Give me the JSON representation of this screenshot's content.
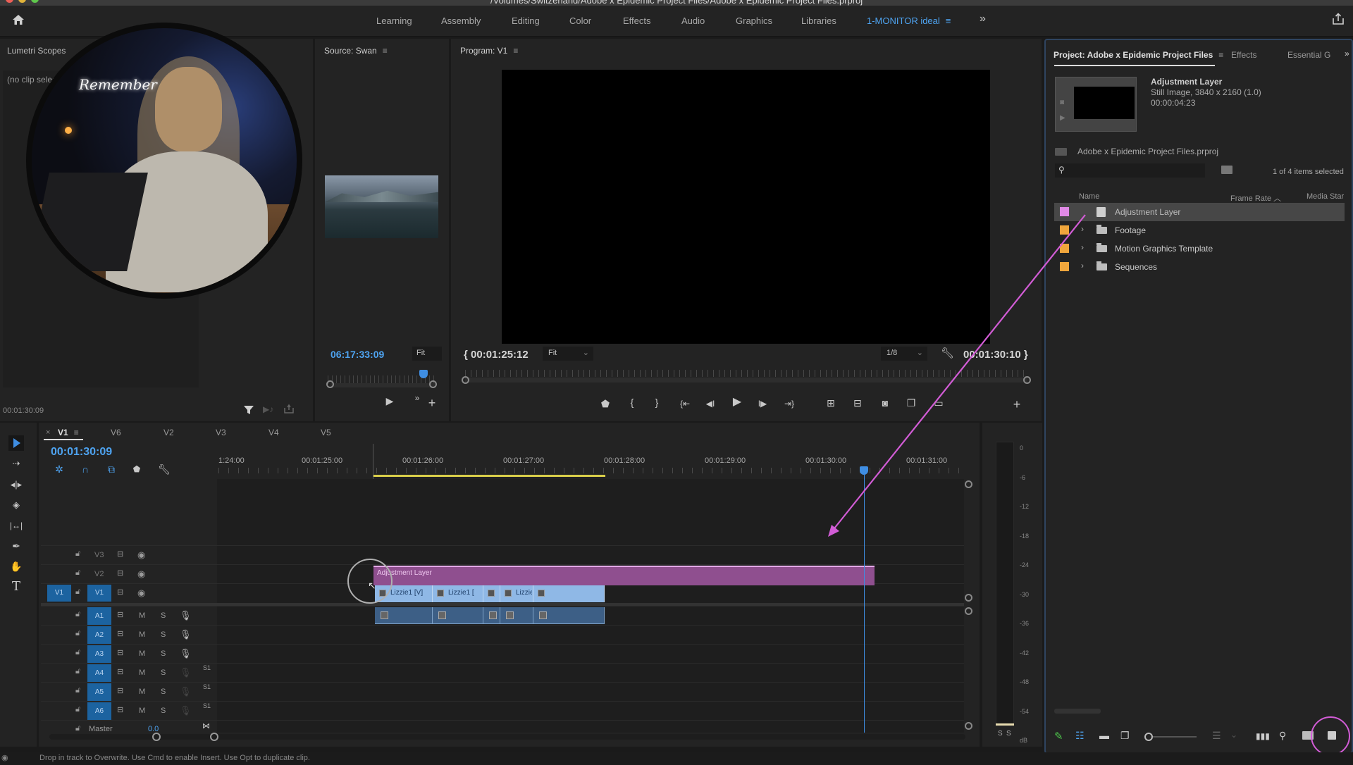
{
  "titlebar": {
    "path": "/Volumes/Switzerland/Adobe x Epidemic Project Files/Adobe x Epidemic Project Files.prproj"
  },
  "workspaces": {
    "items": [
      "Learning",
      "Assembly",
      "Editing",
      "Color",
      "Effects",
      "Audio",
      "Graphics",
      "Libraries",
      "1-MONITOR ideal"
    ],
    "active": "1-MONITOR ideal",
    "more": "»"
  },
  "lumetri": {
    "title": "Lumetri Scopes",
    "no_clip": "(no clip selected)",
    "timecode": "00:01:30:09"
  },
  "source": {
    "title": "Source: Swan",
    "timecode": "06:17:33:09",
    "zoom": "Fit",
    "playhead_fraction": 0.85
  },
  "program": {
    "title": "Program: V1",
    "in_timecode": "00:01:25:12",
    "zoom": "Fit",
    "resolution": "1/8",
    "out_timecode": "00:01:30:10"
  },
  "project": {
    "tabs": [
      "Project: Adobe x Epidemic Project Files",
      "Effects",
      "Essential G"
    ],
    "preview": {
      "name": "Adjustment Layer",
      "info": "Still Image, 3840 x 2160 (1.0)",
      "duration": "00:00:04:23"
    },
    "file": "Adobe x Epidemic Project Files.prproj",
    "search_placeholder": "",
    "selection_status": "1 of 4 items selected",
    "columns": [
      "Name",
      "Frame Rate",
      "Media Star"
    ],
    "items": [
      {
        "name": "Adjustment Layer",
        "color": "#e08ae6",
        "type": "file",
        "selected": true
      },
      {
        "name": "Footage",
        "color": "#f0a63c",
        "type": "folder",
        "selected": false
      },
      {
        "name": "Motion Graphics Template",
        "color": "#f0a63c",
        "type": "folder",
        "selected": false
      },
      {
        "name": "Sequences",
        "color": "#f0a63c",
        "type": "folder",
        "selected": false
      }
    ]
  },
  "timeline": {
    "tabs": [
      "V1",
      "V6",
      "V2",
      "V3",
      "V4",
      "V5"
    ],
    "active_tab": "V1",
    "timecode": "00:01:30:09",
    "ruler": [
      "1:24:00",
      "00:01:25:00",
      "00:01:26:00",
      "00:01:27:00",
      "00:01:28:00",
      "00:01:29:00",
      "00:01:30:00",
      "00:01:31:00"
    ],
    "video_tracks": [
      "V3",
      "V2",
      "V1"
    ],
    "source_patch": "V1",
    "audio_tracks": [
      "A1",
      "A2",
      "A3",
      "A4",
      "A5",
      "A6"
    ],
    "track_labels": {
      "mute": "M",
      "solo": "S",
      "sync": "S1"
    },
    "master": {
      "label": "Master",
      "value": "0.0"
    },
    "adjustment_clip": "Adjustment Layer",
    "video_clips": [
      "Lizzie1 [V]",
      "Lizzie1 [",
      "",
      "Lizzie",
      ""
    ]
  },
  "meter": {
    "scale": [
      "0",
      "-6",
      "-12",
      "-18",
      "-24",
      "-30",
      "-36",
      "-42",
      "-48",
      "-54",
      "dB"
    ],
    "solo": [
      "S",
      "S"
    ]
  },
  "status_bar": {
    "message": "Drop in track to Overwrite. Use Cmd to enable Insert. Use Opt to duplicate clip."
  },
  "colors": {
    "accent": "#4ea3f0",
    "annotation": "#d25cd6",
    "adjustment_clip": "#8f4f8f",
    "video_clip": "#8fb8e6",
    "audio_clip": "#3d5f86"
  }
}
